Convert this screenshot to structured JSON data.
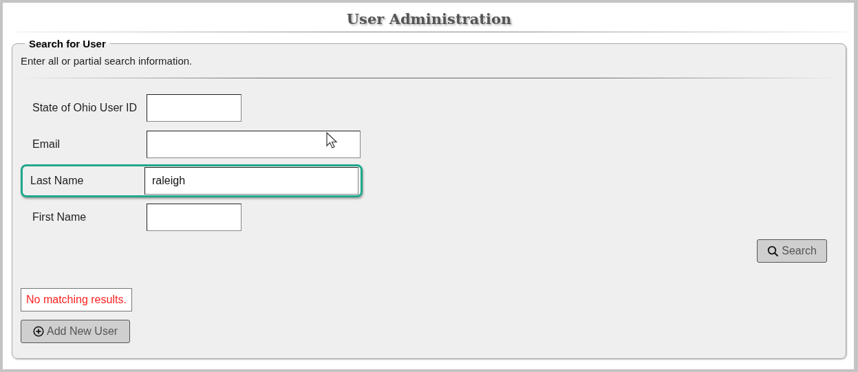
{
  "page": {
    "title": "User Administration"
  },
  "search_panel": {
    "legend": "Search for User",
    "instructions": "Enter all or partial search information.",
    "fields": [
      {
        "label": "State of Ohio User ID",
        "kind": "short",
        "highlighted": false
      },
      {
        "label": "Email",
        "kind": "wide",
        "highlighted": false
      },
      {
        "label": "Last Name",
        "kind": "wide",
        "value": "raleigh",
        "highlighted": true
      },
      {
        "label": "First Name",
        "kind": "short",
        "highlighted": false
      }
    ],
    "search_button": "Search",
    "message": "No matching results.",
    "add_button": "Add New User"
  }
}
